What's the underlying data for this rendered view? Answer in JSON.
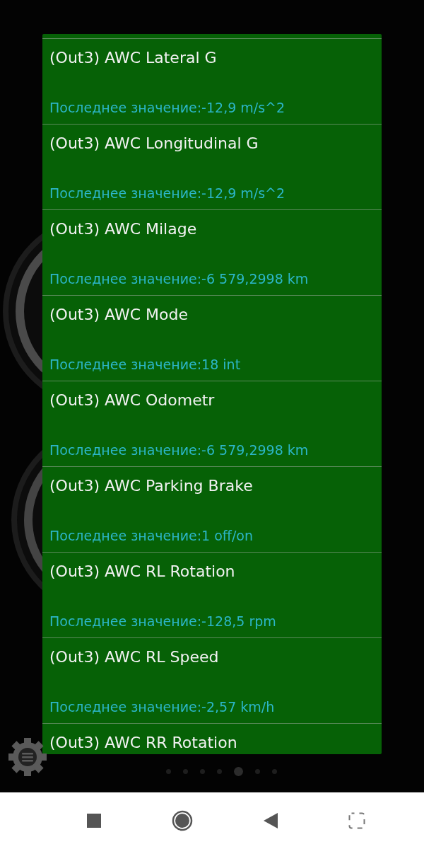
{
  "parameters": [
    {
      "name": "(Out3) AWC Lateral G",
      "last_value": "Последнее значение:-12,9 m/s^2"
    },
    {
      "name": "(Out3) AWC Longitudinal G",
      "last_value": "Последнее значение:-12,9 m/s^2"
    },
    {
      "name": "(Out3) AWC Milage",
      "last_value": "Последнее значение:-6 579,2998 km"
    },
    {
      "name": "(Out3) AWC Mode",
      "last_value": "Последнее значение:18 int"
    },
    {
      "name": "(Out3) AWC Odometr",
      "last_value": "Последнее значение:-6 579,2998 km"
    },
    {
      "name": "(Out3) AWC Parking Brake",
      "last_value": "Последнее значение:1 off/on"
    },
    {
      "name": "(Out3) AWC RL Rotation",
      "last_value": "Последнее значение:-128,5 rpm"
    },
    {
      "name": "(Out3) AWC RL Speed",
      "last_value": "Последнее значение:-2,57 km/h"
    },
    {
      "name": "(Out3) AWC RR Rotation"
    }
  ],
  "pages": [
    {
      "selected": false
    },
    {
      "selected": false
    },
    {
      "selected": false
    },
    {
      "selected": false
    },
    {
      "selected": true
    },
    {
      "selected": false
    },
    {
      "selected": false
    }
  ]
}
